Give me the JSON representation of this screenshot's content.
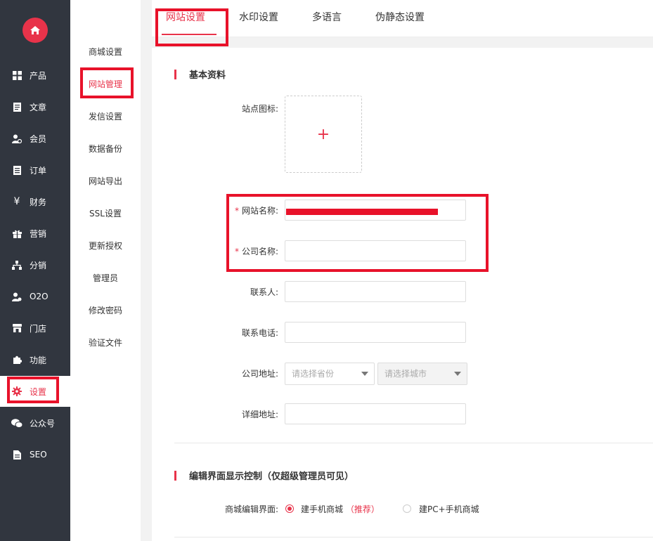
{
  "sidebar": {
    "items": [
      {
        "label": "产品",
        "icon": "grid-icon"
      },
      {
        "label": "文章",
        "icon": "document-icon"
      },
      {
        "label": "会员",
        "icon": "member-icon"
      },
      {
        "label": "订单",
        "icon": "order-list-icon"
      },
      {
        "label": "财务",
        "icon": "yen-icon"
      },
      {
        "label": "营销",
        "icon": "gift-icon"
      },
      {
        "label": "分销",
        "icon": "network-icon"
      },
      {
        "label": "O2O",
        "icon": "o2o-icon"
      },
      {
        "label": "门店",
        "icon": "store-icon"
      },
      {
        "label": "功能",
        "icon": "puzzle-icon"
      },
      {
        "label": "设置",
        "icon": "gear-icon",
        "active": true
      },
      {
        "label": "公众号",
        "icon": "wechat-icon"
      },
      {
        "label": "SEO",
        "icon": "file-icon"
      }
    ]
  },
  "submenu": {
    "items": [
      "商城设置",
      "网站管理",
      "发信设置",
      "数据备份",
      "网站导出",
      "SSL设置",
      "更新授权",
      "管理员",
      "修改密码",
      "验证文件"
    ],
    "active": "网站管理"
  },
  "tabs": [
    "网站设置",
    "水印设置",
    "多语言",
    "伪静态设置"
  ],
  "basic": {
    "title": "基本资料",
    "site_icon_label": "站点图标:",
    "upload_plus": "+",
    "site_name_label": "网站名称:",
    "company_name_label": "公司名称:",
    "contact_label": "联系人:",
    "phone_label": "联系电话:",
    "address_label": "公司地址:",
    "province_placeholder": "请选择省份",
    "city_placeholder": "请选择城市",
    "detail_address_label": "详细地址:",
    "required_mark": "*"
  },
  "edit_control": {
    "title": "编辑界面显示控制（仅超级管理员可见）",
    "label": "商城编辑界面:",
    "option_mobile": "建手机商城",
    "recommend": "（推荐）",
    "option_pc": "建PC+手机商城"
  },
  "colors": {
    "accent": "#e8334a",
    "sidebar_bg": "#31363f"
  }
}
